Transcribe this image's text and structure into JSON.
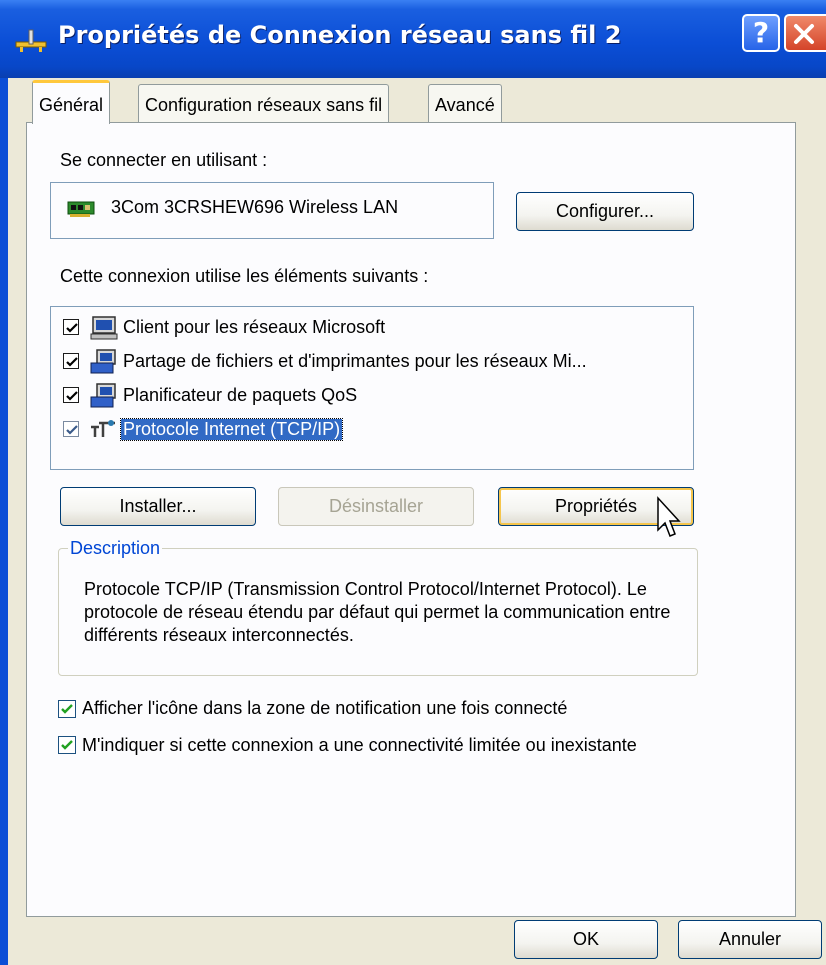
{
  "window": {
    "title": "Propriétés de Connexion réseau sans fil 2",
    "help_icon": "help-icon",
    "help_glyph": "?",
    "close_icon": "close-icon"
  },
  "tabs": [
    {
      "label": "Général",
      "active": true
    },
    {
      "label": "Configuration réseaux sans fil",
      "active": false
    },
    {
      "label": "Avancé",
      "active": false
    }
  ],
  "general": {
    "connect_using_label": "Se connecter en utilisant :",
    "adapter_name": "3Com 3CRSHEW696 Wireless LAN",
    "adapter_icon": "network-card-icon",
    "configure_button": "Configurer...",
    "components_label": "Cette connexion utilise les éléments suivants :",
    "components": [
      {
        "label": "Client pour les réseaux Microsoft",
        "checked": true,
        "selected": false,
        "icon": "network-client-icon"
      },
      {
        "label": "Partage de fichiers et d'imprimantes pour les réseaux Mi...",
        "checked": true,
        "selected": false,
        "icon": "file-printer-sharing-icon"
      },
      {
        "label": "Planificateur de paquets QoS",
        "checked": true,
        "selected": false,
        "icon": "qos-scheduler-icon"
      },
      {
        "label": "Protocole Internet (TCP/IP)",
        "checked": true,
        "selected": true,
        "icon": "protocol-icon"
      }
    ],
    "install_button": "Installer...",
    "uninstall_button": "Désinstaller",
    "properties_button": "Propriétés",
    "description_legend": "Description",
    "description_text": "Protocole TCP/IP (Transmission Control Protocol/Internet Protocol). Le protocole de réseau étendu par défaut qui permet la communication entre différents réseaux interconnectés.",
    "show_icon_option": {
      "label": "Afficher l'icône dans la zone de notification une fois connecté",
      "checked": true
    },
    "notify_limited_option": {
      "label": "M'indiquer si cette connexion a une connectivité limitée ou inexistante",
      "checked": true
    }
  },
  "footer": {
    "ok_button": "OK",
    "cancel_button": "Annuler"
  },
  "colors": {
    "titlebar": "#0b4ed6",
    "selection": "#316ac5",
    "dialog_face": "#ece9d8",
    "tab_highlight": "#ffc83c",
    "group_legend": "#0046d5"
  }
}
